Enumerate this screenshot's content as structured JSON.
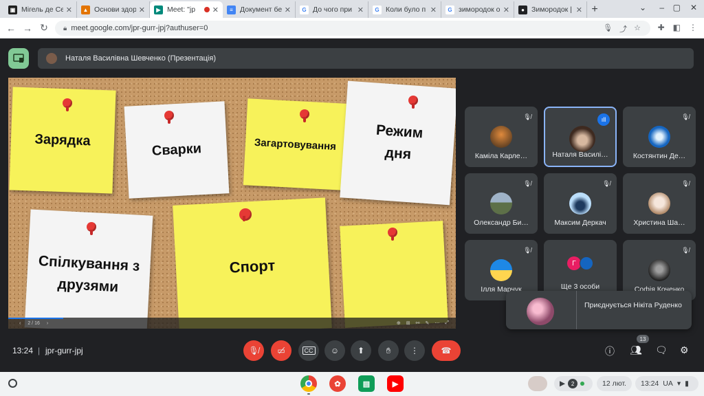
{
  "tabs": [
    {
      "title": "Мігель де Сер",
      "fav_color": "#1f1f1f",
      "fav_glyph": "▣"
    },
    {
      "title": "Основи здоро",
      "fav_color": "#e37400",
      "fav_glyph": "▲"
    },
    {
      "title": "Meet: \"jp",
      "fav_color": "#00897b",
      "fav_glyph": "▶",
      "active": true
    },
    {
      "title": "Документ бе",
      "fav_color": "#4285f4",
      "fav_glyph": "≡"
    },
    {
      "title": "До чого при",
      "fav_color": "#ffffff",
      "fav_glyph": "G"
    },
    {
      "title": "Коли було п",
      "fav_color": "#ffffff",
      "fav_glyph": "G"
    },
    {
      "title": "зимородок о",
      "fav_color": "#ffffff",
      "fav_glyph": "G"
    },
    {
      "title": "Зимородок |",
      "fav_color": "#202124",
      "fav_glyph": "●"
    }
  ],
  "address": {
    "url": "meet.google.com/jpr-gurr-jpj?authuser=0"
  },
  "presenting": {
    "label": "Наталя Василівна Шевченко (Презентація)"
  },
  "slide": {
    "notes": [
      "Зарядка",
      "Сварки",
      "Загартовування",
      "Режим дня",
      "Спілкування з друзями",
      "Спорт",
      ""
    ],
    "page": "2 / 16"
  },
  "participants": [
    {
      "name": "Каміла Карле…",
      "avatar_color": "#6b4a2a"
    },
    {
      "name": "Наталя Василі…",
      "avatar_color": "#5a4436",
      "speaking": true
    },
    {
      "name": "Костянтин Де…",
      "avatar_color": "#1565c0"
    },
    {
      "name": "Олександр Би…",
      "avatar_color": "#6d7f5a"
    },
    {
      "name": "Максим Деркач",
      "avatar_color": "#90caf9"
    },
    {
      "name": "Христина Ша…",
      "avatar_color": "#d7ccc8"
    },
    {
      "name": "Ілля Марчук",
      "avatar_color": "#ffd54f"
    },
    {
      "name": "Ще 3 особи",
      "avatar_color": "#e91e63",
      "more_initial": "Г"
    },
    {
      "name": "Софія Коченко",
      "avatar_color": "#424242"
    }
  ],
  "toast": {
    "text": "Приєднується Нікіта Руденко"
  },
  "controls": {
    "time": "13:24",
    "separator": "|",
    "meeting_code": "jpr-gurr-jpj",
    "participant_count": "13",
    "end_color": "#ea4335"
  },
  "shelf": {
    "date": "12 лют.",
    "time": "13:24",
    "lang": "UA",
    "notif_count": "2"
  }
}
